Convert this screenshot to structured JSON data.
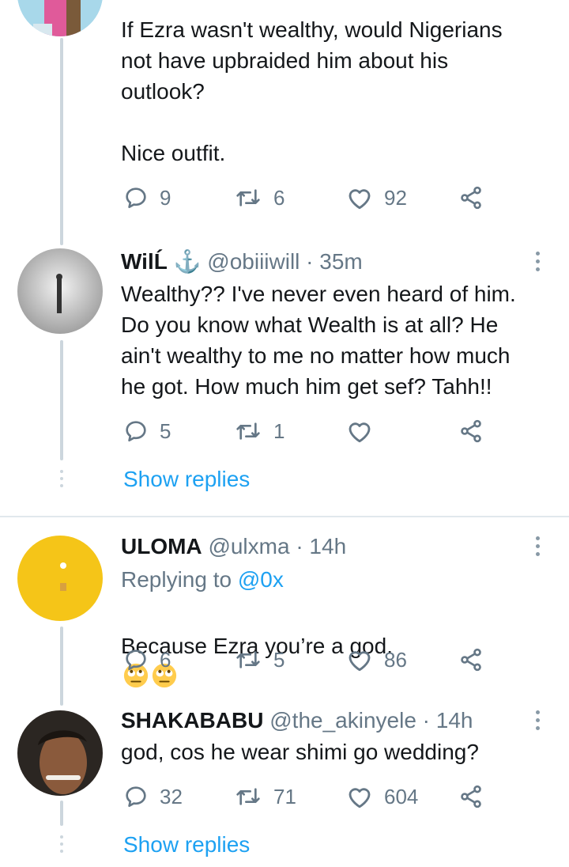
{
  "tweet1": {
    "text": "If Ezra wasn't wealthy, would Nigerians\nnot have upbraided him about his\noutlook?\n\nNice outfit.",
    "replies": "9",
    "retweets": "6",
    "likes": "92"
  },
  "tweet2": {
    "name": "WilĹ ⚓",
    "handle": "@obiiiwill · 35m",
    "text": "Wealthy?? I've never even heard of him.\nDo you know what Wealth is at all? He\nain't wealthy to me no matter how much\nhe got.  How much him get sef? Tahh!!",
    "replies": "5",
    "retweets": "1",
    "likes": "",
    "show_replies": "Show replies"
  },
  "tweet3": {
    "name": "ULOMA",
    "handle": "@ulxma · 14h",
    "replying_prefix": "Replying to ",
    "replying_to": "@0x",
    "text": "Because Ezra you’re a god.",
    "emoji_name": "face-with-rolling-eyes",
    "replies": "6",
    "retweets": "5",
    "likes": "86"
  },
  "tweet4": {
    "name": "SHAKABABU",
    "handle": "@the_akinyele · 14h",
    "text": "god, cos he wear shimi go wedding?",
    "replies": "32",
    "retweets": "71",
    "likes": "604",
    "show_replies": "Show replies"
  },
  "colors": {
    "link": "#1da1f2",
    "secondary": "#657786",
    "thread_line": "#ccd6dd"
  }
}
